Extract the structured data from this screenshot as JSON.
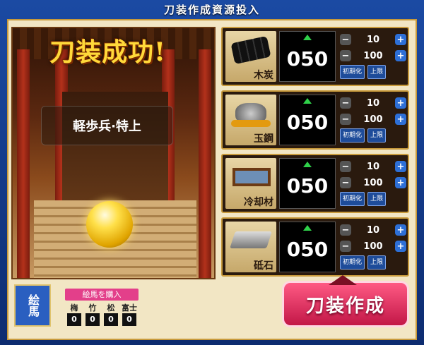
{
  "window": {
    "title": "刀装作成資源投入"
  },
  "scene": {
    "success_text": "刀装成功!",
    "result_text": "軽歩兵·特上"
  },
  "resources": [
    {
      "name": "木炭",
      "icon": "charcoal-icon",
      "value": "050",
      "step_small": "10",
      "step_large": "100",
      "reset_label": "初期化",
      "max_label": "上限"
    },
    {
      "name": "玉鋼",
      "icon": "steel-ore-icon",
      "value": "050",
      "step_small": "10",
      "step_large": "100",
      "reset_label": "初期化",
      "max_label": "上限"
    },
    {
      "name": "冷却材",
      "icon": "coolant-tub-icon",
      "value": "050",
      "step_small": "10",
      "step_large": "100",
      "reset_label": "初期化",
      "max_label": "上限"
    },
    {
      "name": "砥石",
      "icon": "whetstone-icon",
      "value": "050",
      "step_small": "10",
      "step_large": "100",
      "reset_label": "初期化",
      "max_label": "上限"
    }
  ],
  "ema": {
    "label": "絵馬",
    "buy_label": "絵馬を購入",
    "types": [
      "梅",
      "竹",
      "松",
      "富士"
    ],
    "counts": [
      "0",
      "0",
      "0",
      "0"
    ]
  },
  "forge_button": {
    "label": "刀装作成"
  },
  "colors": {
    "frame": "#1b4aa3",
    "panel": "#f2e6c4",
    "forge": "#e33f6a",
    "counter_up": "#2fd14a"
  }
}
